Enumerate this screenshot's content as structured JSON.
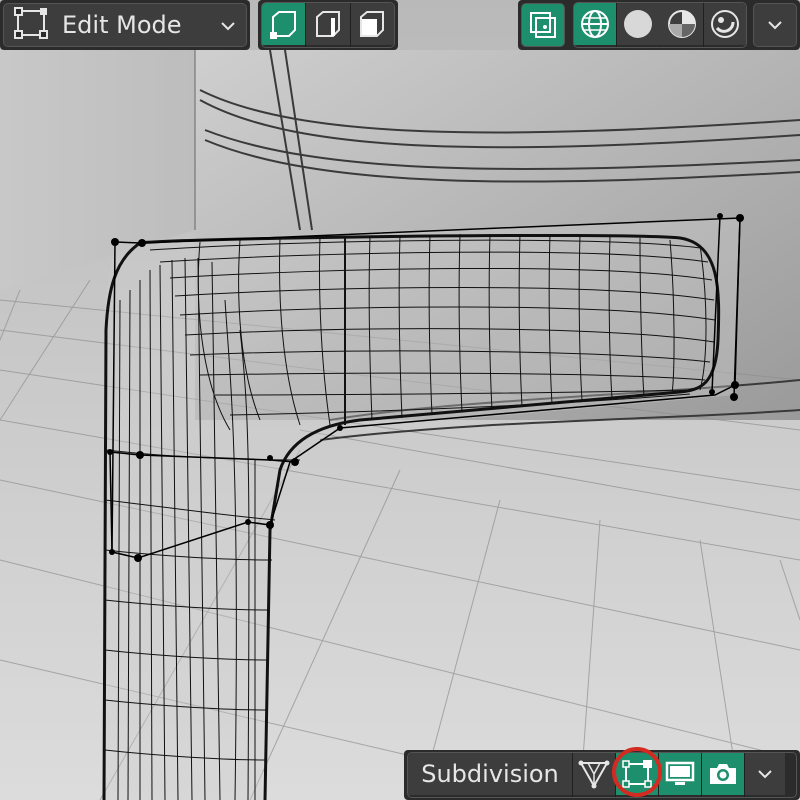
{
  "header": {
    "mode": {
      "label": "Edit Mode",
      "icon": "edit-mode-icon"
    },
    "select_modes": [
      "vertex-select-icon",
      "edge-select-icon",
      "face-select-icon"
    ],
    "active_select_mode": "vertex-select-icon",
    "overlays_icon": "overlays-icon",
    "shading_modes": [
      "wireframe-shading-icon",
      "solid-shading-icon",
      "material-preview-icon",
      "rendered-shading-icon"
    ],
    "active_shading_mode": "wireframe-shading-icon"
  },
  "modifier": {
    "label": "Subdivision",
    "buttons": [
      "on-cage-icon",
      "edit-mode-display-icon",
      "realtime-display-icon",
      "render-display-icon"
    ],
    "highlighted": "edit-mode-display-icon"
  },
  "colors": {
    "accent": "#1e8f6c",
    "header_bg": "#2b2b2b",
    "button_bg": "#3d3d3d",
    "highlight_ring": "#d32a22"
  }
}
